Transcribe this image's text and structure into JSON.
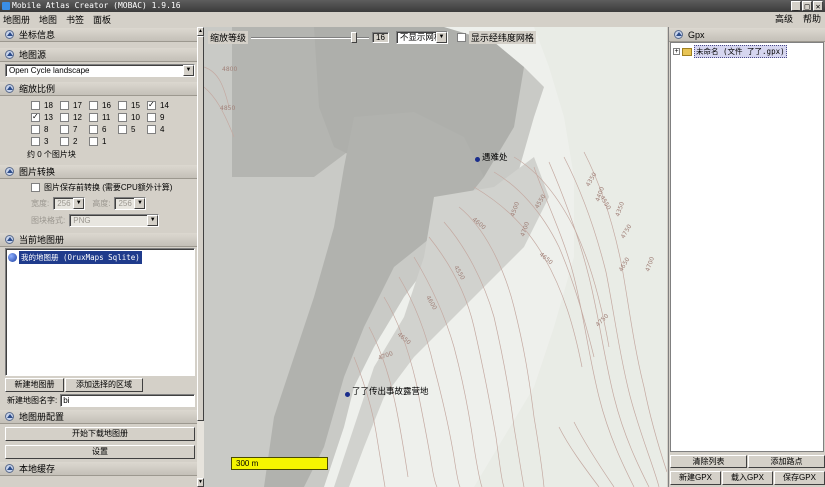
{
  "window": {
    "title": "Mobile Atlas Creator (MOBAC) 1.9.16",
    "buttons": [
      "_",
      "□",
      "✕"
    ]
  },
  "menu": {
    "left": [
      "地图册",
      "地图",
      "书签",
      "面板"
    ],
    "right": [
      "高级",
      "帮助"
    ]
  },
  "sections": {
    "coords": "坐标信息",
    "map_source": "地图源",
    "zoom": "缩放比例",
    "tile_convert": "图片转换",
    "current_atlas": "当前地图册",
    "atlas_settings": "地图册配置",
    "local_cache": "本地缓存"
  },
  "map_source": {
    "selected": "Open Cycle landscape"
  },
  "zoom_levels": [
    {
      "label": "18",
      "checked": false
    },
    {
      "label": "17",
      "checked": false
    },
    {
      "label": "16",
      "checked": false
    },
    {
      "label": "15",
      "checked": false
    },
    {
      "label": "14",
      "checked": true
    },
    {
      "label": "13",
      "checked": true
    },
    {
      "label": "12",
      "checked": false
    },
    {
      "label": "11",
      "checked": false
    },
    {
      "label": "10",
      "checked": false
    },
    {
      "label": "9",
      "checked": false
    },
    {
      "label": "8",
      "checked": false
    },
    {
      "label": "7",
      "checked": false
    },
    {
      "label": "6",
      "checked": false
    },
    {
      "label": "5",
      "checked": false
    },
    {
      "label": "4",
      "checked": false
    },
    {
      "label": "3",
      "checked": false
    },
    {
      "label": "2",
      "checked": false
    },
    {
      "label": "1",
      "checked": false
    }
  ],
  "tile_count_text": "约 0 个图片块",
  "tile_convert": {
    "checkbox_label": "图片保存前转换 (需要CPU额外计算)",
    "width_label": "宽度:",
    "width_value": "256",
    "height_label": "高度:",
    "height_value": "256",
    "format_label": "图块格式:",
    "format_value": "PNG"
  },
  "atlas": {
    "item": "我的地图册 (OruxMaps Sqlite)",
    "new_atlas_button": "新建地图册",
    "add_selection_button": "添加选择的区域",
    "name_label": "新建地图名字:",
    "name_value": "bi"
  },
  "start_download_button": "开始下载地图册",
  "settings_button": "设置",
  "map": {
    "zoom_label": "缩放等级",
    "zoom_value": "16",
    "zoom_fraction": 0.875,
    "grid_select": "不显示网格",
    "latlon_grid_label": "显示经纬度网格",
    "poi_1": "遇难处",
    "poi_2": "了了传出事故露营地",
    "scale": "300 m",
    "contour_labels": [
      "4800",
      "4850",
      "4550",
      "4500",
      "4600",
      "4700",
      "4650",
      "4750",
      "4550",
      "4650",
      "4700",
      "4400",
      "4350",
      "4350",
      "4550",
      "4600",
      "4650",
      "4700",
      "4750"
    ]
  },
  "gpx": {
    "title": "Gpx",
    "tree_item": "未命名 (文件 了了.gpx)",
    "clear_list_button": "清除列表",
    "add_point_button": "添加路点",
    "new_gpx_button": "新建GPX",
    "load_gpx_button": "载入GPX",
    "save_gpx_button": "保存GPX"
  }
}
